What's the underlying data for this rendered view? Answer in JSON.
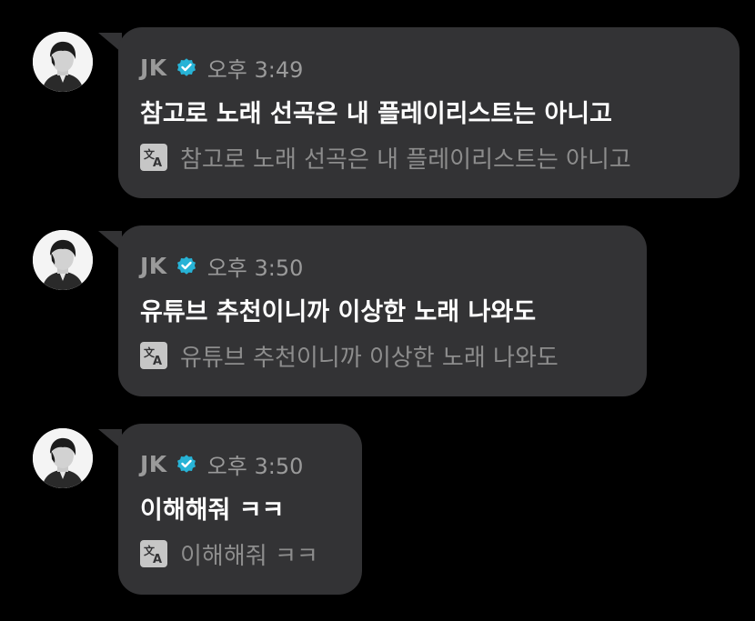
{
  "messages": [
    {
      "sender": "JK",
      "time": "오후 3:49",
      "text": "참고로 노래 선곡은 내 플레이리스트는 아니고",
      "translation": "참고로 노래 선곡은 내 플레이리스트는 아니고"
    },
    {
      "sender": "JK",
      "time": "오후 3:50",
      "text": "유튜브 추천이니까 이상한 노래 나와도",
      "translation": "유튜브 추천이니까 이상한 노래 나와도"
    },
    {
      "sender": "JK",
      "time": "오후 3:50",
      "text": "이해해줘 ㅋㅋ",
      "translation": "이해해줘 ㅋㅋ"
    }
  ],
  "colors": {
    "background": "#000000",
    "bubble": "#333335",
    "verified_badge": "#27b3d6",
    "meta_text": "#9a9a9a",
    "translation_text": "#8d8d8d"
  },
  "icons": {
    "verified": "verified-badge-icon",
    "translate": "translate-icon",
    "avatar": "profile-avatar"
  }
}
